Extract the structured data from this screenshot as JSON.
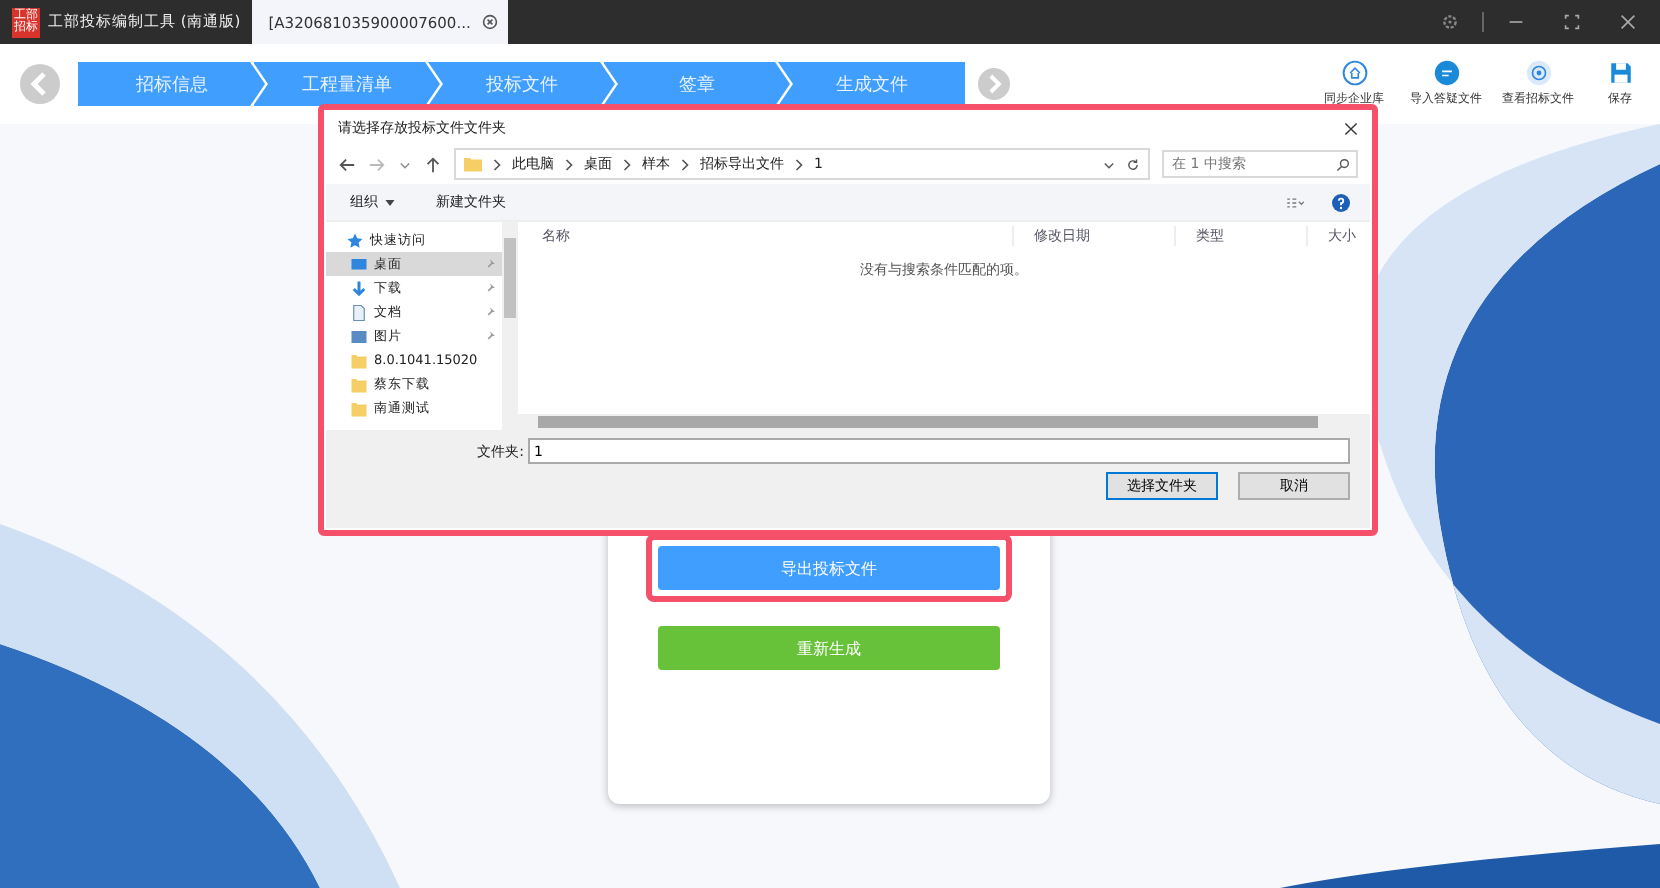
{
  "app": {
    "logo": [
      "工部",
      "招标"
    ],
    "title": "工部投标编制工具 (南通版)"
  },
  "tabs": [
    {
      "label": "[A320681035900007600...",
      "selected": true
    }
  ],
  "steps": [
    {
      "label": "招标信息"
    },
    {
      "label": "工程量清单"
    },
    {
      "label": "投标文件"
    },
    {
      "label": "签章"
    },
    {
      "label": "生成文件"
    }
  ],
  "toolbar": [
    {
      "label": "同步企业库",
      "kind": "sync"
    },
    {
      "label": "导入答疑文件",
      "kind": "answer"
    },
    {
      "label": "查看招标文件",
      "kind": "view"
    },
    {
      "label": "保存",
      "kind": "save"
    }
  ],
  "dialog": {
    "title": "请选择存放投标文件文件夹",
    "path": [
      "此电脑",
      "桌面",
      "样本",
      "招标导出文件",
      "1"
    ],
    "search": {
      "placeholder": "在 1 中搜索"
    },
    "commands": [
      {
        "label": "组织",
        "dropdown": true
      },
      {
        "label": "新建文件夹",
        "dropdown": false
      }
    ],
    "sidebar": [
      {
        "label": "快速访问",
        "kind": "star",
        "selected": false,
        "children": [
          {
            "label": "桌面",
            "kind": "desktop",
            "selected": true,
            "pinned": true
          },
          {
            "label": "下载",
            "kind": "download",
            "selected": false,
            "pinned": true
          },
          {
            "label": "文档",
            "kind": "doc",
            "selected": false,
            "pinned": true
          },
          {
            "label": "图片",
            "kind": "picture",
            "selected": false,
            "pinned": true
          },
          {
            "label": "8.0.1041.15020",
            "kind": "folder",
            "selected": false
          },
          {
            "label": "蔡东下载",
            "kind": "folder",
            "selected": false
          },
          {
            "label": "南通测试",
            "kind": "folder",
            "selected": false
          }
        ]
      }
    ],
    "columns": [
      "名称",
      "修改日期",
      "类型",
      "大小"
    ],
    "empty_message": "没有与搜索条件匹配的项。",
    "folder_label": "文件夹:",
    "folder_value": "1",
    "buttons": [
      {
        "label": "选择文件夹",
        "primary": true
      },
      {
        "label": "取消",
        "primary": false
      }
    ]
  },
  "actions": [
    {
      "label": "导出投标文件",
      "kind": "export",
      "highlighted": true
    },
    {
      "label": "重新生成",
      "kind": "regenerate",
      "highlighted": false
    }
  ]
}
